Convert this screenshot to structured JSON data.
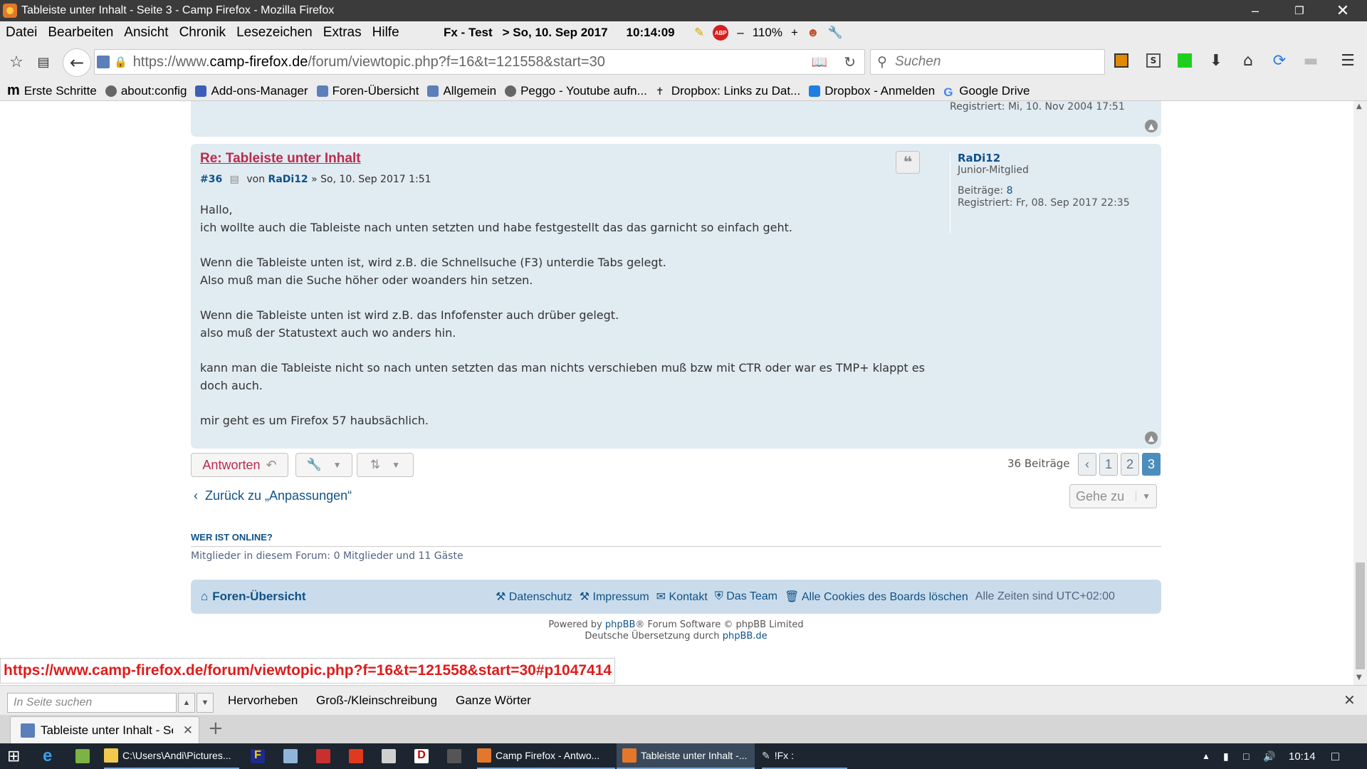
{
  "window": {
    "title": "Tableiste unter Inhalt - Seite 3 - Camp Firefox - Mozilla Firefox"
  },
  "menubar": {
    "items": [
      "Datei",
      "Bearbeiten",
      "Ansicht",
      "Chronik",
      "Lesezeichen",
      "Extras",
      "Hilfe"
    ],
    "fx_label": "Fx - Test",
    "date_label": "> So, 10. Sep 2017",
    "time_label": "10:14:09",
    "zoom_level": "110%"
  },
  "navbar": {
    "url_prefix": "https://www.",
    "url_host": "camp-firefox.de",
    "url_path": "/forum/viewtopic.php?f=16&t=121558&start=30",
    "search_placeholder": "Suchen"
  },
  "bookmarks": [
    "Erste Schritte",
    "about:config",
    "Add-ons-Manager",
    "Foren-Übersicht",
    "Allgemein",
    "Peggo - Youtube aufn...",
    "Dropbox: Links zu Dat...",
    "Dropbox - Anmelden",
    "Google Drive"
  ],
  "prev_post": {
    "registered_label": "Registriert:",
    "registered_value": "Mi, 10. Nov 2004 17:51"
  },
  "post": {
    "title": "Re: Tableiste unter Inhalt",
    "number": "#36",
    "by_label": "von",
    "author": "RaDi12",
    "date": "» So, 10. Sep 2017 1:51",
    "body": [
      "Hallo,\nich wollte auch die Tableiste nach unten setzten und habe festgestellt das das garnicht so einfach geht.",
      "Wenn die Tableiste unten ist, wird z.B. die Schnellsuche (F3) unterdie Tabs gelegt.\nAlso muß man die Suche höher oder woanders hin setzen.",
      "Wenn die Tableiste unten ist wird z.B. das Infofenster auch drüber gelegt.\nalso muß der Statustext auch wo anders hin.",
      "kann man die Tableiste nicht so nach unten setzten das man nichts verschieben muß bzw mit CTR oder war es TMP+ klappt es\ndoch auch.",
      "mir geht es um Firefox 57 haubsächlich."
    ],
    "profile": {
      "username": "RaDi12",
      "rank": "Junior-Mitglied",
      "posts_label": "Beiträge:",
      "posts_value": "8",
      "registered_label": "Registriert:",
      "registered_value": "Fr, 08. Sep 2017 22:35"
    }
  },
  "actions": {
    "reply_label": "Antworten",
    "post_count": "36 Beiträge",
    "pages": [
      "1",
      "2",
      "3"
    ],
    "current_page": "3",
    "back_link": "Zurück zu „Anpassungen“",
    "jump_label": "Gehe zu"
  },
  "online": {
    "heading": "WER IST ONLINE?",
    "text": "Mitglieder in diesem Forum: 0 Mitglieder und 11 Gäste"
  },
  "footer": {
    "home": "Foren-Übersicht",
    "links": [
      "Datenschutz",
      "Impressum",
      "Kontakt",
      "Das Team",
      "Alle Cookies des Boards löschen"
    ],
    "timezone": "Alle Zeiten sind UTC+02:00",
    "powered_prefix": "Powered by",
    "powered_link": "phpBB",
    "powered_suffix": "® Forum Software © phpBB Limited",
    "translation_prefix": "Deutsche Übersetzung durch",
    "translation_link": "phpBB.de"
  },
  "statuslink": "https://www.camp-firefox.de/forum/viewtopic.php?f=16&t=121558&start=30#p1047414",
  "findbar": {
    "placeholder": "In Seite suchen",
    "highlight": "Hervorheben",
    "matchcase": "Groß-/Kleinschreibung",
    "wholewords": "Ganze Wörter"
  },
  "tabs": [
    {
      "label": "Tableiste unter Inhalt - Se"
    }
  ],
  "taskbar": {
    "items": [
      "C:\\Users\\Andi\\Pictures...",
      "Camp Firefox - Antwo...",
      "Tableiste unter Inhalt -...",
      "!Fx :"
    ],
    "clock": "10:14"
  },
  "colors": {
    "accent_red": "#bc2a4d",
    "link_blue": "#105289",
    "post_bg": "#e1ebf2",
    "footer_bg": "#cadceb",
    "page_active": "#4c8dbb"
  }
}
